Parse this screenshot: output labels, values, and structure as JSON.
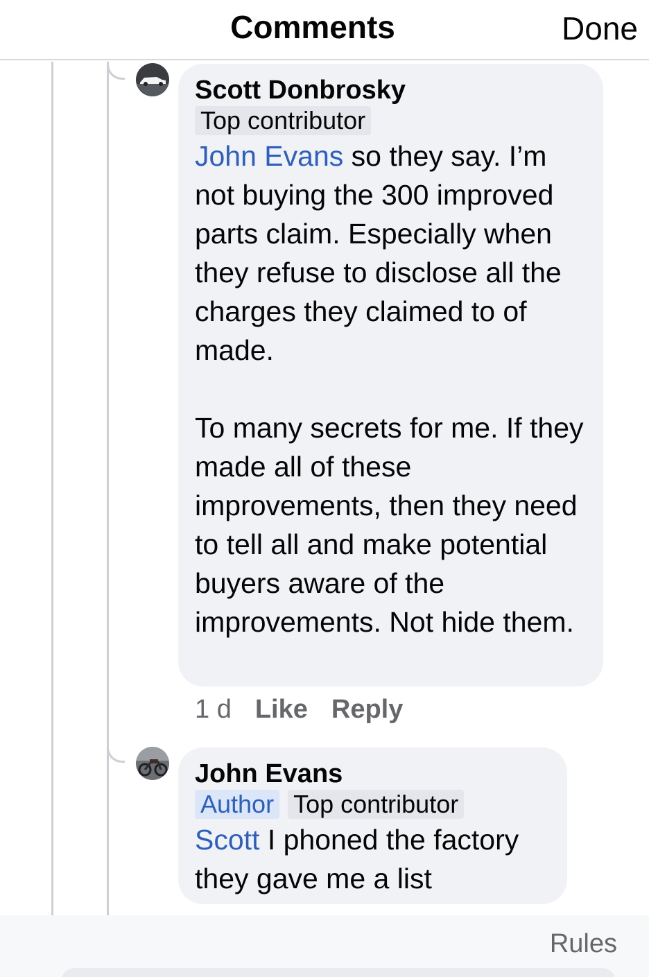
{
  "header": {
    "title": "Comments",
    "done_label": "Done"
  },
  "comments": [
    {
      "author": "Scott Donbrosky",
      "badges": [
        "Top contributor"
      ],
      "mention": "John Evans",
      "text": " so they say.  I’m not buying the 300 improved parts claim.  Especially when they refuse to disclose all the charges they claimed to of made.\n\nTo many secrets for me.  If they made all of these improvements, then they need to tell all and make potential buyers aware of the improvements.   Not hide them.",
      "time": "1 d",
      "like_label": "Like",
      "reply_label": "Reply"
    },
    {
      "author": "John Evans",
      "badges": [
        "Author",
        "Top contributor"
      ],
      "mention": "Scott",
      "text": " I phoned the factory they gave me a list"
    }
  ],
  "footer": {
    "rules_label": "Rules"
  }
}
